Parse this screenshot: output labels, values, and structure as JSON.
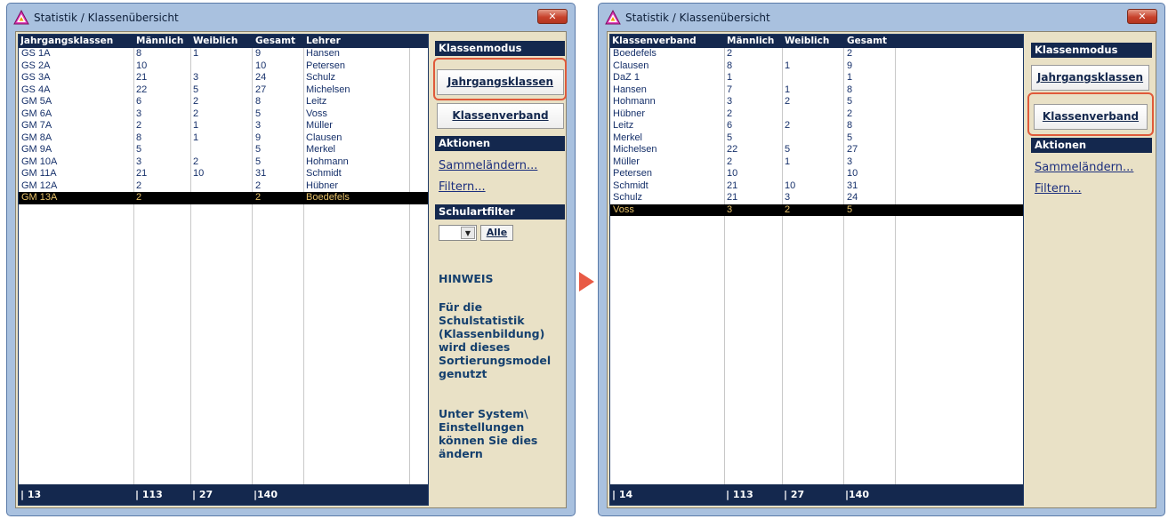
{
  "left": {
    "title": "Statistik / Klassenübersicht",
    "columns": [
      "Jahrgangsklassen",
      "Männlich",
      "Weiblich",
      "Gesamt",
      "Lehrer"
    ],
    "rows": [
      [
        "GS 1A",
        "8",
        "1",
        "9",
        "Hansen"
      ],
      [
        "GS 2A",
        "10",
        "",
        "10",
        "Petersen"
      ],
      [
        "GS 3A",
        "21",
        "3",
        "24",
        "Schulz"
      ],
      [
        "GS 4A",
        "22",
        "5",
        "27",
        "Michelsen"
      ],
      [
        "GM 5A",
        "6",
        "2",
        "8",
        "Leitz"
      ],
      [
        "GM 6A",
        "3",
        "2",
        "5",
        "Voss"
      ],
      [
        "GM 7A",
        "2",
        "1",
        "3",
        "Müller"
      ],
      [
        "GM 8A",
        "8",
        "1",
        "9",
        "Clausen"
      ],
      [
        "GM 9A",
        "5",
        "",
        "5",
        "Merkel"
      ],
      [
        "GM 10A",
        "3",
        "2",
        "5",
        "Hohmann"
      ],
      [
        "GM 11A",
        "21",
        "10",
        "31",
        "Schmidt"
      ],
      [
        "GM 12A",
        "2",
        "",
        "2",
        "Hübner"
      ],
      [
        "GM 13A",
        "2",
        "",
        "2",
        "Boedefels"
      ]
    ],
    "selected_row": 12,
    "footer": [
      "13",
      "113",
      "27",
      "140"
    ],
    "sidebar": {
      "section_mode": "Klassenmodus",
      "btn_jahrgang": "Jahrgangsklassen",
      "btn_verband": "Klassenverband",
      "section_actions": "Aktionen",
      "link_sammel": "Sammeländern...",
      "link_filter": "Filtern...",
      "section_schulart": "Schulartfilter",
      "btn_alle": "Alle",
      "hinweis_title": "HINWEIS",
      "hinweis_1": "Für die Schulstatistik (Klassenbildung) wird dieses Sortierungsmodel genutzt",
      "hinweis_2": "Unter System\\ Einstellungen können Sie dies ändern"
    }
  },
  "right": {
    "title": "Statistik / Klassenübersicht",
    "columns": [
      "Klassenverband",
      "Männlich",
      "Weiblich",
      "Gesamt"
    ],
    "rows": [
      [
        "Boedefels",
        "2",
        "",
        "2"
      ],
      [
        "Clausen",
        "8",
        "1",
        "9"
      ],
      [
        "DaZ 1",
        "1",
        "",
        "1"
      ],
      [
        "Hansen",
        "7",
        "1",
        "8"
      ],
      [
        "Hohmann",
        "3",
        "2",
        "5"
      ],
      [
        "Hübner",
        "2",
        "",
        "2"
      ],
      [
        "Leitz",
        "6",
        "2",
        "8"
      ],
      [
        "Merkel",
        "5",
        "",
        "5"
      ],
      [
        "Michelsen",
        "22",
        "5",
        "27"
      ],
      [
        "Müller",
        "2",
        "1",
        "3"
      ],
      [
        "Petersen",
        "10",
        "",
        "10"
      ],
      [
        "Schmidt",
        "21",
        "10",
        "31"
      ],
      [
        "Schulz",
        "21",
        "3",
        "24"
      ],
      [
        "Voss",
        "3",
        "2",
        "5"
      ]
    ],
    "selected_row": 13,
    "footer": [
      "14",
      "113",
      "27",
      "140"
    ],
    "sidebar": {
      "section_mode": "Klassenmodus",
      "btn_jahrgang": "Jahrgangsklassen",
      "btn_verband": "Klassenverband",
      "section_actions": "Aktionen",
      "link_sammel": "Sammeländern...",
      "link_filter": "Filtern..."
    }
  },
  "colors": {
    "header": "#14284e",
    "selection": "#000000",
    "highlight": "#e05a3a",
    "panel": "#e9e1c6"
  }
}
